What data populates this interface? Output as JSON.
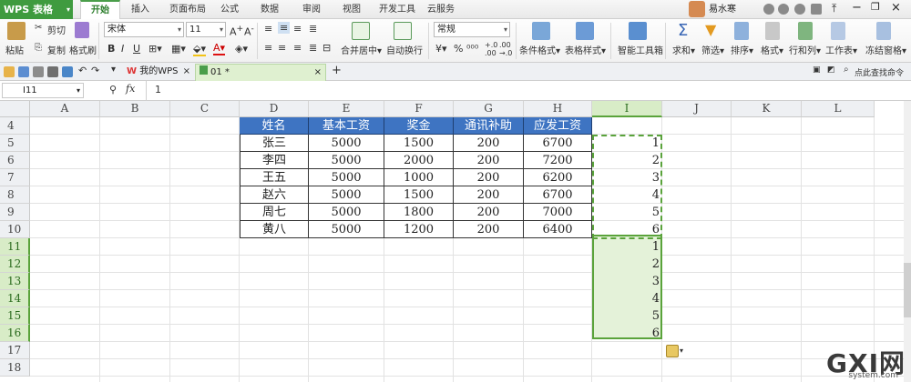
{
  "app": {
    "logo": "WPS 表格"
  },
  "menu": [
    "开始",
    "插入",
    "页面布局",
    "公式",
    "数据",
    "审阅",
    "视图",
    "开发工具",
    "云服务"
  ],
  "active_menu": "开始",
  "user": {
    "name": "易水寒"
  },
  "ribbon": {
    "paste": "粘贴",
    "cut": "剪切",
    "copy": "复制",
    "format_painter": "格式刷",
    "font_name": "宋体",
    "font_size": "11",
    "merge_center": "合并居中",
    "wrap_text": "自动换行",
    "number_format": "常规",
    "percent": "%",
    "conditional_format": "条件格式",
    "table_style": "表格样式",
    "smart_toolbox": "智能工具箱",
    "sum": "求和",
    "filter": "筛选",
    "sort": "排序",
    "format": "格式",
    "row_col": "行和列",
    "worksheet": "工作表",
    "freeze": "冻结窗格"
  },
  "tabs": {
    "home": "我的WPS",
    "doc": "01 *",
    "search_hint": "点此查找命令"
  },
  "formula_bar": {
    "cell_ref": "I11",
    "fx": "fx",
    "value": "1"
  },
  "columns": [
    "A",
    "B",
    "C",
    "D",
    "E",
    "F",
    "G",
    "H",
    "I",
    "J",
    "K",
    "L"
  ],
  "rows": [
    "4",
    "5",
    "6",
    "7",
    "8",
    "9",
    "10",
    "11",
    "12",
    "13",
    "14",
    "15",
    "16",
    "17",
    "18"
  ],
  "table": {
    "headers": [
      "姓名",
      "基本工资",
      "奖金",
      "通讯补助",
      "应发工资"
    ],
    "rows": [
      [
        "张三",
        "5000",
        "1500",
        "200",
        "6700"
      ],
      [
        "李四",
        "5000",
        "2000",
        "200",
        "7200"
      ],
      [
        "王五",
        "5000",
        "1000",
        "200",
        "6200"
      ],
      [
        "赵六",
        "5000",
        "1500",
        "200",
        "6700"
      ],
      [
        "周七",
        "5000",
        "1800",
        "200",
        "7000"
      ],
      [
        "黄八",
        "5000",
        "1200",
        "200",
        "6400"
      ]
    ]
  },
  "column_i": {
    "top": [
      "1",
      "2",
      "3",
      "4",
      "5",
      "6"
    ],
    "bottom": [
      "1",
      "2",
      "3",
      "4",
      "5",
      "6"
    ]
  },
  "watermark": {
    "main": "GXI网",
    "sub": "system.com"
  },
  "colors": {
    "accent": "#4a9e4a",
    "header_fill": "#3e74c2",
    "selection_fill": "#e4f2d9"
  }
}
